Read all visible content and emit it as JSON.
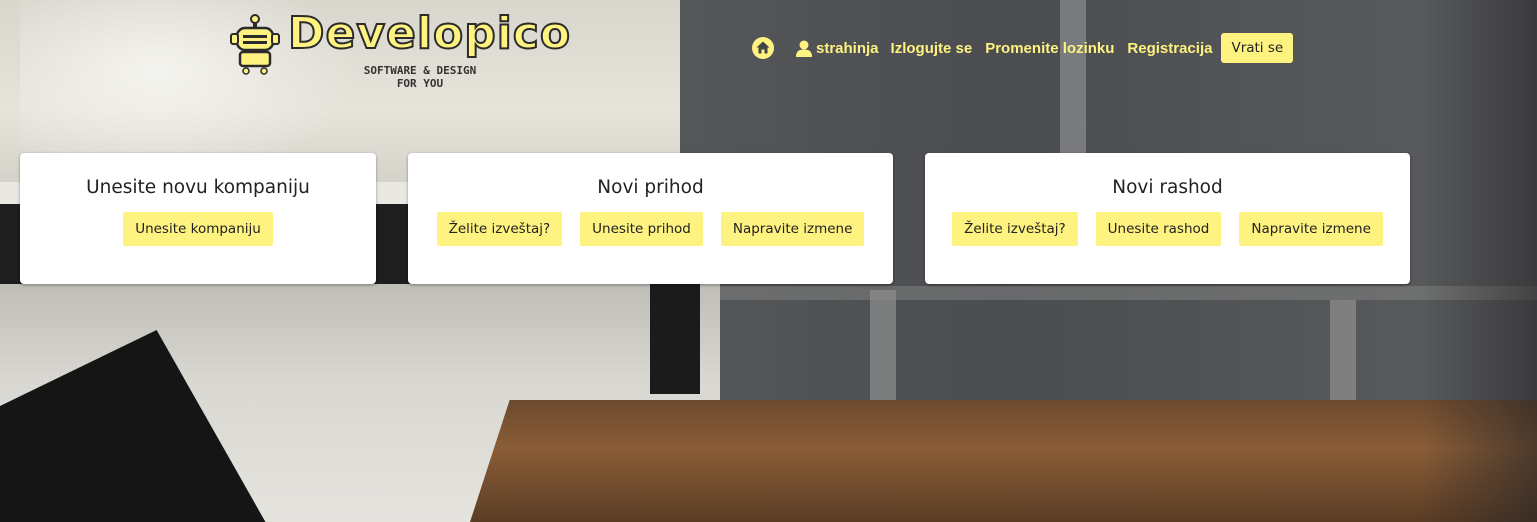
{
  "brand": {
    "name": "Developico",
    "tagline": "SOFTWARE & DESIGN\nFOR YOU",
    "primary_color": "#fef280"
  },
  "nav": {
    "home_icon": "home-icon",
    "user_icon": "user-icon",
    "username": "strahinja",
    "logout": "Izlogujte se",
    "change_password": "Promenite lozinku",
    "register": "Registracija",
    "back": "Vrati se"
  },
  "cards": {
    "company": {
      "title": "Unesite novu kompaniju",
      "buttons": [
        "Unesite kompaniju"
      ]
    },
    "income": {
      "title": "Novi prihod",
      "buttons": [
        "Želite izveštaj?",
        "Unesite prihod",
        "Napravite izmene"
      ]
    },
    "expense": {
      "title": "Novi rashod",
      "buttons": [
        "Želite izveštaj?",
        "Unesite rashod",
        "Napravite izmene"
      ]
    }
  }
}
